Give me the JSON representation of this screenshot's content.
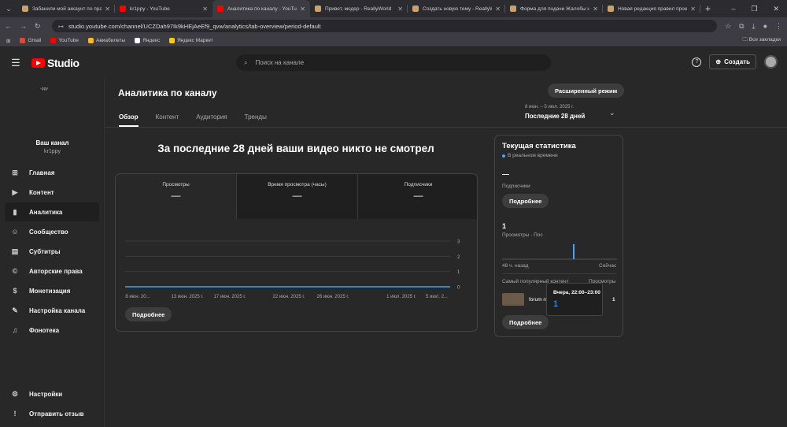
{
  "browser": {
    "tabs": [
      {
        "title": "Забанили мой аккаунт по пра",
        "color": "#c9a36b"
      },
      {
        "title": "kr1ppy - YouTube",
        "color": "#ff0000"
      },
      {
        "title": "Аналитика по каналу - YouTub",
        "color": "#ff0000"
      },
      {
        "title": "Привет, модер - ReallyWorld",
        "color": "#c9a36b"
      },
      {
        "title": "Создать новую тему - ReallyW",
        "color": "#c9a36b"
      },
      {
        "title": "Форма для подачи Жалобы н",
        "color": "#c9a36b"
      },
      {
        "title": "Новая редакция правил прое",
        "color": "#c9a36b"
      }
    ],
    "url": "studio.youtube.com/channel/UCZDah97Ik9kHEjAeEf9_qvw/analytics/tab-overview/period-default",
    "bookmarks": [
      {
        "label": "Gmail",
        "color": "#ea4335"
      },
      {
        "label": "YouTube",
        "color": "#ff0000"
      },
      {
        "label": "Авиабилеты",
        "color": "#f5b82e"
      },
      {
        "label": "Яндекс",
        "color": "#ffffff"
      },
      {
        "label": "Яндекс Маркет",
        "color": "#ffcc00"
      }
    ],
    "all_bookmarks": "Все закладки"
  },
  "header": {
    "logo_text": "Studio",
    "search_placeholder": "Поиск на канале",
    "create_label": "Создать"
  },
  "sidebar": {
    "channel_logo_text": "-ppy",
    "channel_name": "Ваш канал",
    "channel_handle": "kr1ppy",
    "items": [
      {
        "label": "Главная",
        "icon": "⊞"
      },
      {
        "label": "Контент",
        "icon": "▶"
      },
      {
        "label": "Аналитика",
        "icon": "▮"
      },
      {
        "label": "Сообщество",
        "icon": "☺"
      },
      {
        "label": "Субтитры",
        "icon": "▤"
      },
      {
        "label": "Авторские права",
        "icon": "©"
      },
      {
        "label": "Монетизация",
        "icon": "$"
      },
      {
        "label": "Настройка канала",
        "icon": "✎"
      },
      {
        "label": "Фонотека",
        "icon": "♫"
      }
    ],
    "bottom": [
      {
        "label": "Настройки",
        "icon": "⚙"
      },
      {
        "label": "Отправить отзыв",
        "icon": "!"
      }
    ]
  },
  "main": {
    "title": "Аналитика по каналу",
    "advanced_mode": "Расширенный режим",
    "tabs": [
      "Обзор",
      "Контент",
      "Аудитория",
      "Тренды"
    ],
    "period_range": "8 июн. – 5 июл. 2025 г.",
    "period_label": "Последние 28 дней",
    "headline": "За последние 28 дней ваши видео никто не смотрел",
    "metrics": [
      {
        "label": "Просмотры",
        "value": "—"
      },
      {
        "label": "Время просмотра (часы)",
        "value": "—"
      },
      {
        "label": "Подписчики",
        "value": "—"
      }
    ],
    "more_label": "Подробнее"
  },
  "chart_data": {
    "type": "line",
    "x": [
      "8 июн. 20...",
      "13 июн. 2025 г.",
      "17 июн. 2025 г.",
      "22 июн. 2025 г.",
      "26 июн. 2025 г.",
      "1 июл. 2025 г.",
      "5 июл. 2..."
    ],
    "series": [
      {
        "values": [
          0,
          0,
          0,
          0,
          0,
          0,
          0
        ]
      }
    ],
    "y_ticks": [
      "3",
      "2",
      "1",
      "0"
    ],
    "ylim": [
      0,
      3
    ],
    "grid": true,
    "color": "#3ea6ff"
  },
  "realtime": {
    "title": "Текущая статистика",
    "live_label": "В реальном времени",
    "subs_value": "—",
    "subs_label": "Подписчики",
    "more_label": "Подробнее",
    "views_value": "1",
    "views_label": "Просмотры · Пос",
    "range_start": "48 ч. назад",
    "range_end": "Сейчас",
    "top_content_label": "Самый популярный контент",
    "top_views_label": "Просмотры",
    "top_item_title": "forum rw",
    "top_item_views": "1",
    "tooltip_title": "Вчера, 22:00–23:00",
    "tooltip_value": "1",
    "more_label2": "Подробнее"
  }
}
